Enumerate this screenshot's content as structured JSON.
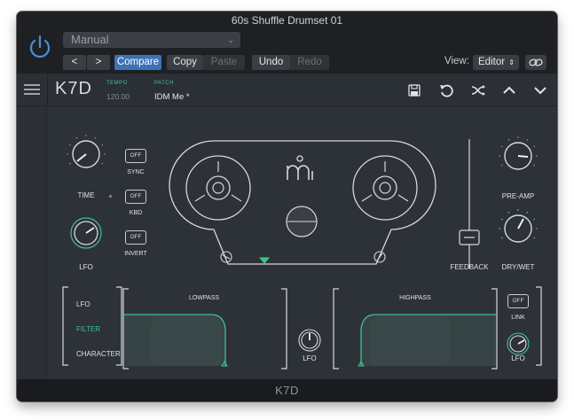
{
  "host": {
    "title": "60s Shuffle Drumset 01",
    "preset": "Manual",
    "prev_label": "<",
    "next_label": ">",
    "compare_label": "Compare",
    "copy_label": "Copy",
    "paste_label": "Paste",
    "undo_label": "Undo",
    "redo_label": "Redo",
    "view_label": "View:",
    "view_value": "Editor"
  },
  "plugin": {
    "name": "K7D",
    "tempo_label": "TEMPO",
    "tempo_value": "120.00",
    "patch_label": "PATCH",
    "patch_value": "IDM Me *",
    "footer_name": "K7D"
  },
  "controls": {
    "time_label": "TIME",
    "lfo_label": "LFO",
    "sync": {
      "label": "SYNC",
      "state": "OFF"
    },
    "kbd": {
      "label": "KBD",
      "state": "OFF"
    },
    "invert": {
      "label": "INVERT",
      "state": "OFF"
    },
    "feedback_label": "FEEDBACK",
    "preamp_label": "PRE-AMP",
    "drywet_label": "DRY/WET"
  },
  "filter_section": {
    "tabs": [
      "LFO",
      "FILTER",
      "CHARACTER"
    ],
    "active_tab": "FILTER",
    "lowpass_label": "LOWPASS",
    "highpass_label": "HIGHPASS",
    "lfo_label": "LFO",
    "link": {
      "label": "LINK",
      "state": "OFF"
    },
    "right_lfo_label": "LFO"
  },
  "colors": {
    "accent_green": "#3ec48e",
    "compare_blue": "#3d72b6",
    "power_blue": "#4a8fd9"
  }
}
